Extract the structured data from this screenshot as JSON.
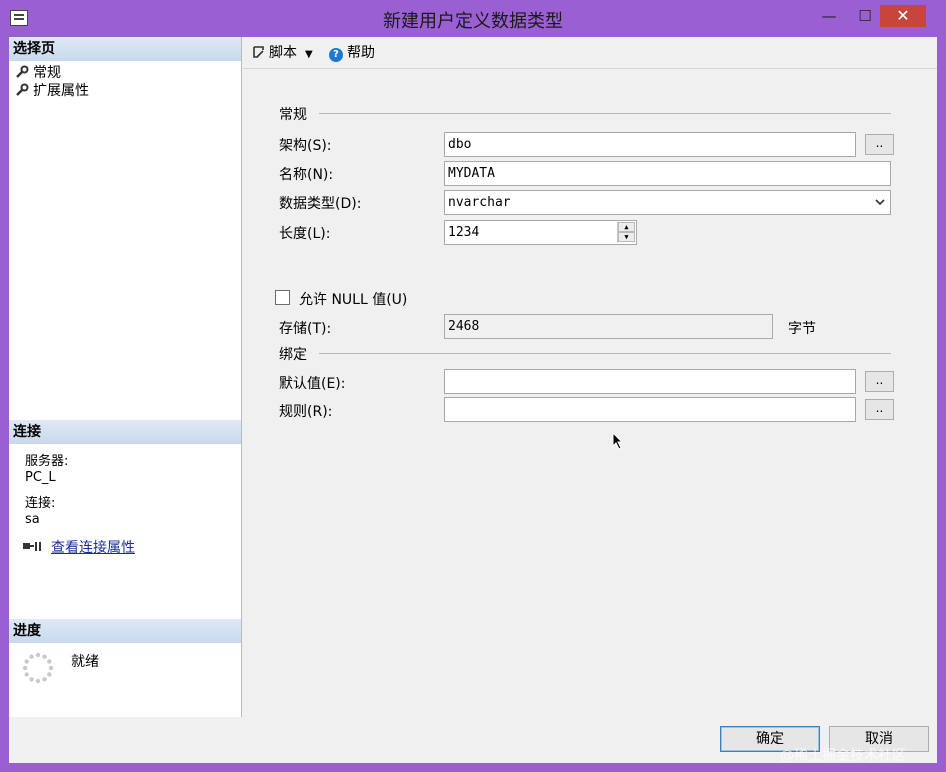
{
  "window": {
    "title": "新建用户定义数据类型",
    "minimize": "—",
    "maximize": "☐",
    "close": "✕"
  },
  "left": {
    "select_page_header": "选择页",
    "pages": [
      {
        "label": "常规",
        "icon": "wrench-icon"
      },
      {
        "label": "扩展属性",
        "icon": "wrench-icon"
      }
    ],
    "connection_header": "连接",
    "server_label": "服务器:",
    "server_value": "PC_L",
    "connection_label": "连接:",
    "connection_value": "sa",
    "view_props_link": "查看连接属性",
    "progress_header": "进度",
    "progress_status": "就绪"
  },
  "toolbar": {
    "script_label": "脚本",
    "help_label": "帮助"
  },
  "form": {
    "general_group": "常规",
    "schema_label": "架构(S):",
    "schema_value": "dbo",
    "name_label": "名称(N):",
    "name_value": "MYDATA",
    "datatype_label": "数据类型(D):",
    "datatype_value": "nvarchar",
    "length_label": "长度(L):",
    "length_value": "1234",
    "allow_null_label": "允许 NULL 值(U)",
    "allow_null_checked": false,
    "storage_label": "存储(T):",
    "storage_value": "2468",
    "storage_unit": "字节",
    "binding_group": "绑定",
    "default_label": "默认值(E):",
    "default_value": "",
    "rule_label": "规则(R):",
    "rule_value": "",
    "ellipsis": ".."
  },
  "buttons": {
    "ok": "确定",
    "cancel": "取消"
  },
  "watermark": "@稀土掘金技术社区",
  "colors": {
    "frame": "#9a5fd1",
    "section_header": "#c9d9ee",
    "close_button": "#c8453b",
    "link": "#1a2f9c"
  }
}
